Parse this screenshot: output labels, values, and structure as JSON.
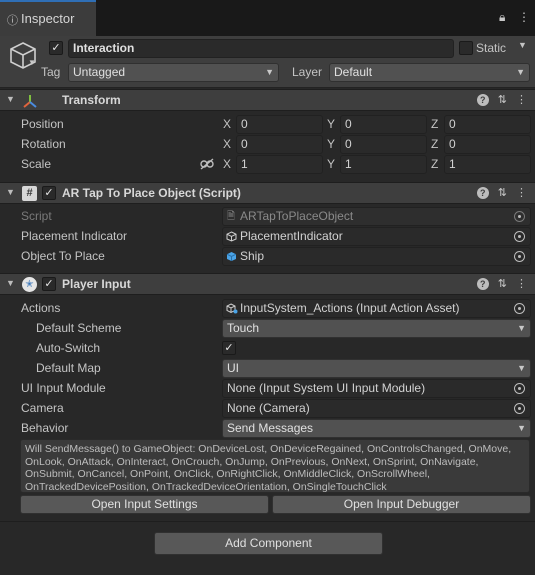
{
  "tab": {
    "label": "Inspector"
  },
  "header": {
    "name": "Interaction",
    "static_label": "Static",
    "tag_label": "Tag",
    "tag_value": "Untagged",
    "layer_label": "Layer",
    "layer_value": "Default"
  },
  "transform": {
    "title": "Transform",
    "rows": [
      {
        "label": "Position",
        "x": "0",
        "y": "0",
        "z": "0"
      },
      {
        "label": "Rotation",
        "x": "0",
        "y": "0",
        "z": "0"
      },
      {
        "label": "Scale",
        "x": "1",
        "y": "1",
        "z": "1"
      }
    ],
    "axis": {
      "x": "X",
      "y": "Y",
      "z": "Z"
    }
  },
  "artap": {
    "title": "AR Tap To Place Object (Script)",
    "script_label": "Script",
    "script_value": "ARTapToPlaceObject",
    "indicator_label": "Placement Indicator",
    "indicator_value": "PlacementIndicator",
    "object_label": "Object To Place",
    "object_value": "Ship"
  },
  "playerinput": {
    "title": "Player Input",
    "actions_label": "Actions",
    "actions_value": "InputSystem_Actions (Input Action Asset)",
    "scheme_label": "Default Scheme",
    "scheme_value": "Touch",
    "autoswitch_label": "Auto-Switch",
    "map_label": "Default Map",
    "map_value": "UI",
    "uimodule_label": "UI Input Module",
    "uimodule_value": "None (Input System UI Input Module)",
    "camera_label": "Camera",
    "camera_value": "None (Camera)",
    "behavior_label": "Behavior",
    "behavior_value": "Send Messages",
    "help_text": "Will SendMessage() to GameObject: OnDeviceLost, OnDeviceRegained, OnControlsChanged, OnMove, OnLook, OnAttack, OnInteract, OnCrouch, OnJump, OnPrevious, OnNext, OnSprint, OnNavigate, OnSubmit, OnCancel, OnPoint, OnClick, OnRightClick, OnMiddleClick, OnScrollWheel, OnTrackedDevicePosition, OnTrackedDeviceOrientation, OnSingleTouchClick",
    "settings_button": "Open Input Settings",
    "debugger_button": "Open Input Debugger"
  },
  "add_component": "Add Component"
}
